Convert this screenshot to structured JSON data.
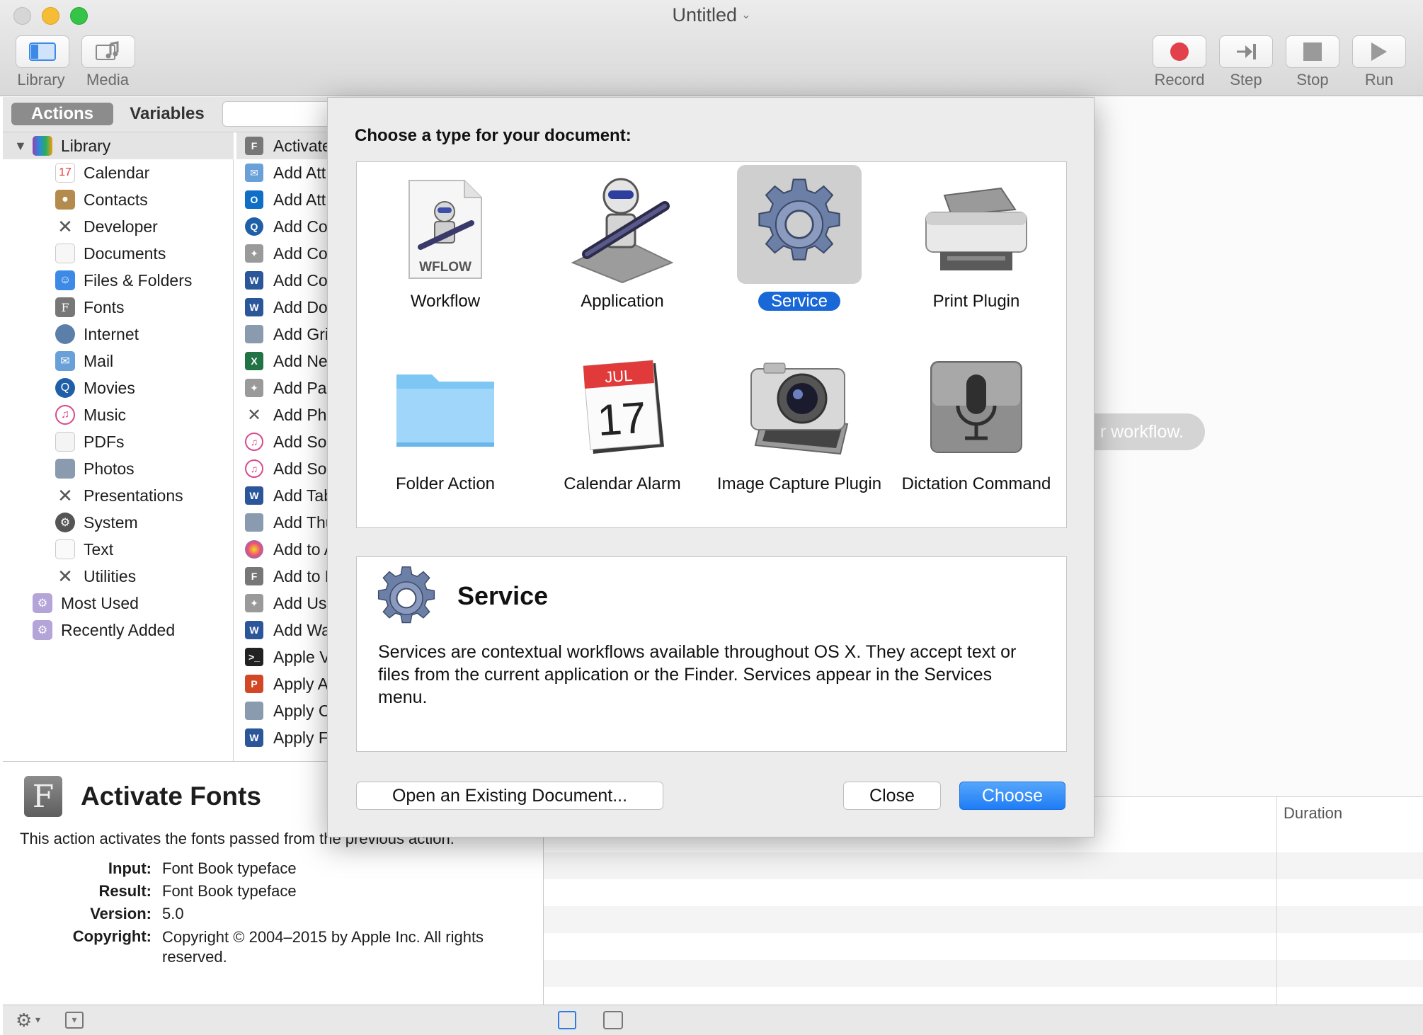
{
  "window": {
    "title": "Untitled"
  },
  "toolbar": {
    "library": "Library",
    "media": "Media",
    "record": "Record",
    "step": "Step",
    "stop": "Stop",
    "run": "Run"
  },
  "left_tabs": {
    "actions": "Actions",
    "variables": "Variables"
  },
  "library": {
    "root": "Library",
    "categories": [
      "Calendar",
      "Contacts",
      "Developer",
      "Documents",
      "Files & Folders",
      "Fonts",
      "Internet",
      "Mail",
      "Movies",
      "Music",
      "PDFs",
      "Photos",
      "Presentations",
      "System",
      "Text",
      "Utilities"
    ],
    "smart_groups": [
      "Most Used",
      "Recently Added"
    ]
  },
  "actions_list": [
    "Activate",
    "Add Att",
    "Add Att",
    "Add Col",
    "Add Co",
    "Add Co",
    "Add Doc",
    "Add Gri",
    "Add Ne",
    "Add Pac",
    "Add Pho",
    "Add Sor",
    "Add Sor",
    "Add Tab",
    "Add Thu",
    "Add to A",
    "Add to F",
    "Add Use",
    "Add Wa",
    "Apple V",
    "Apply A",
    "Apply C",
    "Apply F"
  ],
  "description": {
    "title": "Activate Fonts",
    "summary": "This action activates the fonts passed from the previous action.",
    "input_label": "Input:",
    "input": "Font Book typeface",
    "result_label": "Result:",
    "result": "Font Book typeface",
    "version_label": "Version:",
    "version": "5.0",
    "copyright_label": "Copyright:",
    "copyright": "Copyright © 2004–2015 by Apple Inc. All rights reserved."
  },
  "workflow": {
    "hint": "r workflow.",
    "duration_header": "Duration"
  },
  "sheet": {
    "prompt": "Choose a type for your document:",
    "types": [
      {
        "label": "Workflow",
        "icon": "workflow-doc-icon"
      },
      {
        "label": "Application",
        "icon": "automator-robot-icon"
      },
      {
        "label": "Service",
        "icon": "gear-icon"
      },
      {
        "label": "Print Plugin",
        "icon": "printer-icon"
      },
      {
        "label": "Folder Action",
        "icon": "folder-icon"
      },
      {
        "label": "Calendar Alarm",
        "icon": "calendar-icon"
      },
      {
        "label": "Image Capture Plugin",
        "icon": "camera-icon"
      },
      {
        "label": "Dictation Command",
        "icon": "microphone-icon"
      }
    ],
    "selected": "Service",
    "wflow_badge": "WFLOW",
    "cal_month": "JUL",
    "cal_day": "17",
    "detail_title": "Service",
    "detail_text": "Services are contextual workflows available throughout OS X. They accept text or files from the current application or the Finder. Services appear in the Services menu.",
    "open_existing": "Open an Existing Document...",
    "close": "Close",
    "choose": "Choose"
  },
  "colors": {
    "accent": "#1968d8",
    "record_red": "#e0414b"
  }
}
